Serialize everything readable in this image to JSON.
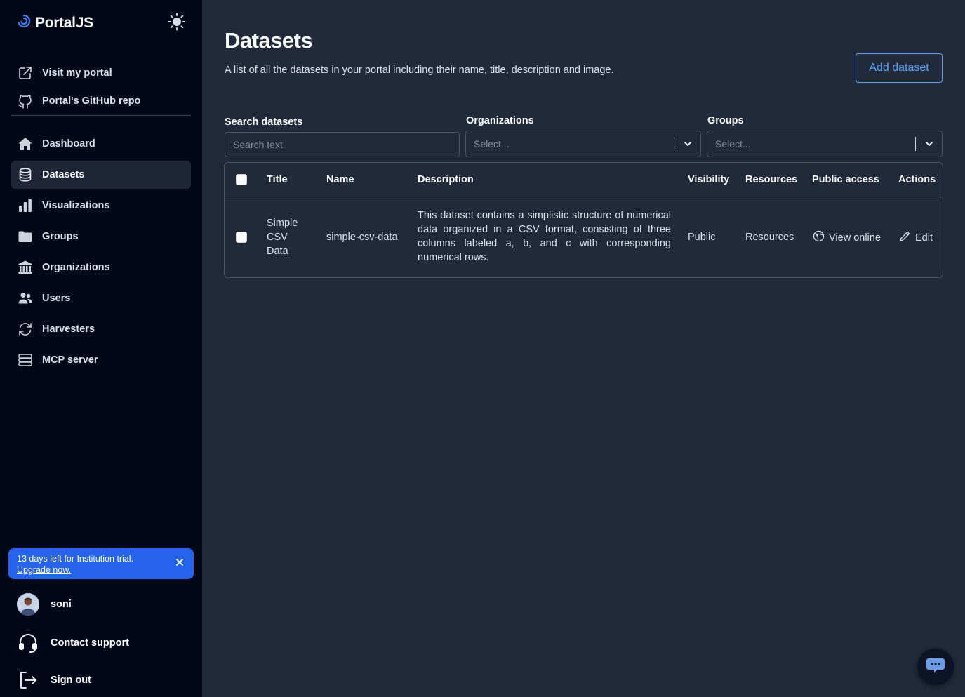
{
  "brand": {
    "name": "PortalJS"
  },
  "sidebar": {
    "top_links": [
      {
        "label": "Visit my portal",
        "icon": "external-link-icon"
      },
      {
        "label": "Portal's GitHub repo",
        "icon": "github-icon"
      }
    ],
    "items": [
      {
        "label": "Dashboard",
        "icon": "home-icon"
      },
      {
        "label": "Datasets",
        "icon": "database-icon",
        "active": true
      },
      {
        "label": "Visualizations",
        "icon": "bar-chart-icon"
      },
      {
        "label": "Groups",
        "icon": "folder-icon"
      },
      {
        "label": "Organizations",
        "icon": "building-icon"
      },
      {
        "label": "Users",
        "icon": "users-icon"
      },
      {
        "label": "Harvesters",
        "icon": "refresh-icon"
      },
      {
        "label": "MCP server",
        "icon": "server-icon"
      }
    ],
    "trial": {
      "text": "13 days left for Institution trial.",
      "link": "Upgrade now."
    },
    "user": {
      "name": "soni"
    },
    "contact_support": "Contact support",
    "sign_out": "Sign out"
  },
  "main": {
    "title": "Datasets",
    "description": "A list of all the datasets in your portal including their name, title, description and image.",
    "add_button": "Add dataset",
    "filters": {
      "search_label": "Search datasets",
      "search_placeholder": "Search text",
      "organizations_label": "Organizations",
      "organizations_placeholder": "Select...",
      "groups_label": "Groups",
      "groups_placeholder": "Select..."
    },
    "table": {
      "headers": [
        "Title",
        "Name",
        "Description",
        "Visibility",
        "Resources",
        "Public access",
        "Actions"
      ],
      "rows": [
        {
          "title_lines": [
            "Simple",
            "CSV",
            "Data"
          ],
          "name": "simple-csv-data",
          "description": "This dataset contains a simplistic structure of numerical data organized in a CSV format, consisting of three columns labeled a, b, and c with corresponding numerical rows.",
          "visibility": "Public",
          "resources": "Resources",
          "public_access": "View online",
          "action": "Edit"
        }
      ]
    }
  },
  "colors": {
    "sidebar_bg": "#020817",
    "main_bg": "#212a3b",
    "accent": "#60a5fa",
    "trial_bg": "#2563eb"
  }
}
